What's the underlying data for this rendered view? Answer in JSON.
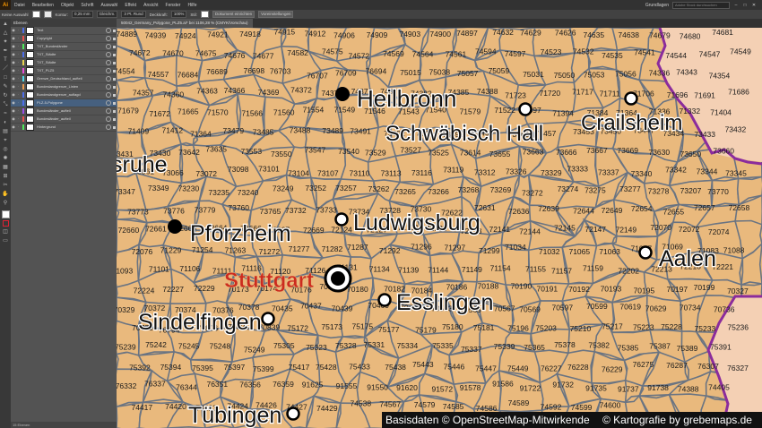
{
  "app": {
    "logo": "Ai",
    "menu": [
      "Datei",
      "Bearbeiten",
      "Objekt",
      "Schrift",
      "Auswahl",
      "Effekt",
      "Ansicht",
      "Fenster",
      "Hilfe"
    ],
    "workspace": "Grundlagen",
    "search_placeholder": "Adobe Stock durchsuchen",
    "window_buttons": [
      "–",
      "□",
      "✕"
    ]
  },
  "controlbar": {
    "selection_label": "Keine Auswahl",
    "stroke_label": "Kontur:",
    "stroke_value": "0,25 mm",
    "style_value": "Gleichm.",
    "brush_value": "3 Pt. Rund",
    "opacity_label": "Deckkraft:",
    "opacity_value": "100%",
    "style_label": "Stil:",
    "doc_setup_button": "Dokument einrichten",
    "prefs_button": "Voreinstellungen"
  },
  "document": {
    "tab_title": "50042_Germany_Polygone_PLZ5.ai* bei 1106,28 % (CMYK/Vorschau)"
  },
  "layers_panel": {
    "title": "Ebenen",
    "footer": "15 Ebenen",
    "layers": [
      {
        "name": "Text",
        "color": "#4f6ee8",
        "selected": false
      },
      {
        "name": "Copyright",
        "color": "#e84f4f",
        "selected": false
      },
      {
        "name": "TXT_Bundesländer",
        "color": "#4fe85a",
        "selected": false
      },
      {
        "name": "TXT_Städte",
        "color": "#4f6ee8",
        "selected": false
      },
      {
        "name": "TXT_Städte",
        "color": "#e8d24f",
        "selected": false
      },
      {
        "name": "TXT_PLZ5",
        "color": "#e84fd8",
        "selected": false
      },
      {
        "name": "Grenze_Deutschland_aufteil",
        "color": "#4fd8e8",
        "selected": false
      },
      {
        "name": "Bundeslandgrenze_Linien",
        "color": "#e89a4f",
        "selected": false
      },
      {
        "name": "Bundeslandgrenze_auflagd",
        "color": "#4f6ee8",
        "selected": false
      },
      {
        "name": "PLZ-5-Polygone",
        "color": "#4f6ee8",
        "selected": true
      },
      {
        "name": "Bundesländer_aufteil",
        "color": "#9a4fe8",
        "selected": false
      },
      {
        "name": "Bundesländer_aufteil",
        "color": "#e84f4f",
        "selected": false
      },
      {
        "name": "Hintergrund",
        "color": "#4fe85a",
        "selected": false
      }
    ]
  },
  "map": {
    "colors": {
      "land": "#e9b97d",
      "borders": "#6a7482",
      "neighbor": "#f4d0b4",
      "state_border": "#8b2c9c",
      "city_label": "#111111",
      "capital_label": "#cc2b1f"
    },
    "cities": [
      {
        "name": "Heilbronn",
        "marker": "filled"
      },
      {
        "name": "Schwäbisch Hall",
        "marker": "hollow"
      },
      {
        "name": "Crailsheim",
        "marker": "hollow"
      },
      {
        "name": "Ludwigsburg",
        "marker": "hollow"
      },
      {
        "name": "Pforzheim",
        "marker": "filled"
      },
      {
        "name": "Aalen",
        "marker": "hollow"
      },
      {
        "name": "Stuttgart",
        "marker": "capital"
      },
      {
        "name": "Esslingen",
        "marker": "hollow"
      },
      {
        "name": "Sindelfingen",
        "marker": "hollow"
      },
      {
        "name": "Tübingen",
        "marker": "hollow"
      },
      {
        "name": "sruhe",
        "marker": "none"
      }
    ],
    "postcodes": [
      {
        "code": "74889"
      },
      {
        "code": "74939"
      },
      {
        "code": "74924"
      },
      {
        "code": "74921"
      },
      {
        "code": "74918"
      },
      {
        "code": "74915"
      },
      {
        "code": "74912"
      },
      {
        "code": "74906"
      },
      {
        "code": "74909"
      },
      {
        "code": "74903"
      },
      {
        "code": "74900"
      },
      {
        "code": "74897"
      },
      {
        "code": "74632"
      },
      {
        "code": "74629"
      },
      {
        "code": "74626"
      },
      {
        "code": "74635"
      },
      {
        "code": "74638"
      },
      {
        "code": "74679"
      },
      {
        "code": "74680"
      },
      {
        "code": "74681"
      },
      {
        "code": "74672"
      },
      {
        "code": "74670"
      },
      {
        "code": "74675"
      },
      {
        "code": "74676"
      },
      {
        "code": "74677"
      },
      {
        "code": "74582"
      },
      {
        "code": "74575"
      },
      {
        "code": "74572"
      },
      {
        "code": "74569"
      },
      {
        "code": "74564"
      },
      {
        "code": "74561"
      },
      {
        "code": "74594"
      },
      {
        "code": "74597"
      },
      {
        "code": "74523"
      },
      {
        "code": "74532"
      },
      {
        "code": "74535"
      },
      {
        "code": "74541"
      },
      {
        "code": "74544"
      },
      {
        "code": "74547"
      },
      {
        "code": "74549"
      },
      {
        "code": "74554"
      },
      {
        "code": "74557"
      },
      {
        "code": "76684"
      },
      {
        "code": "76689"
      },
      {
        "code": "76698"
      },
      {
        "code": "76703"
      },
      {
        "code": "76707"
      },
      {
        "code": "76709"
      },
      {
        "code": "76694"
      },
      {
        "code": "75015"
      },
      {
        "code": "75038"
      },
      {
        "code": "75057"
      },
      {
        "code": "75059"
      },
      {
        "code": "75031"
      },
      {
        "code": "75050"
      },
      {
        "code": "75053"
      },
      {
        "code": "75056"
      },
      {
        "code": "74336"
      },
      {
        "code": "74343"
      },
      {
        "code": "74354"
      },
      {
        "code": "74357"
      },
      {
        "code": "74360"
      },
      {
        "code": "74363"
      },
      {
        "code": "74366"
      },
      {
        "code": "74369"
      },
      {
        "code": "74372"
      },
      {
        "code": "74374"
      },
      {
        "code": "74376"
      },
      {
        "code": "74379"
      },
      {
        "code": "74382"
      },
      {
        "code": "74385"
      },
      {
        "code": "74388"
      },
      {
        "code": "71723"
      },
      {
        "code": "71720"
      },
      {
        "code": "71717"
      },
      {
        "code": "71711"
      },
      {
        "code": "71706"
      },
      {
        "code": "71696"
      },
      {
        "code": "71691"
      },
      {
        "code": "71686"
      },
      {
        "code": "71679"
      },
      {
        "code": "71672"
      },
      {
        "code": "71665"
      },
      {
        "code": "71570"
      },
      {
        "code": "71566"
      },
      {
        "code": "71560"
      },
      {
        "code": "71554"
      },
      {
        "code": "71549"
      },
      {
        "code": "71546"
      },
      {
        "code": "71543"
      },
      {
        "code": "71540"
      },
      {
        "code": "71579"
      },
      {
        "code": "71522"
      },
      {
        "code": "71397"
      },
      {
        "code": "71394"
      },
      {
        "code": "71384"
      },
      {
        "code": "71364"
      },
      {
        "code": "71336"
      },
      {
        "code": "71332"
      },
      {
        "code": "71404"
      },
      {
        "code": "71409"
      },
      {
        "code": "71412"
      },
      {
        "code": "71364"
      },
      {
        "code": "73479"
      },
      {
        "code": "73485"
      },
      {
        "code": "73488"
      },
      {
        "code": "73489"
      },
      {
        "code": "73491"
      },
      {
        "code": "73492"
      },
      {
        "code": "73494"
      },
      {
        "code": "73495"
      },
      {
        "code": "73466"
      },
      {
        "code": "73460"
      },
      {
        "code": "73457"
      },
      {
        "code": "73453"
      },
      {
        "code": "73450"
      },
      {
        "code": "73447"
      },
      {
        "code": "73434"
      },
      {
        "code": "73433"
      },
      {
        "code": "73432"
      },
      {
        "code": "73431"
      },
      {
        "code": "73430"
      },
      {
        "code": "73642"
      },
      {
        "code": "73635"
      },
      {
        "code": "73553"
      },
      {
        "code": "73550"
      },
      {
        "code": "73547"
      },
      {
        "code": "73540"
      },
      {
        "code": "73529"
      },
      {
        "code": "73527"
      },
      {
        "code": "73525"
      },
      {
        "code": "73614"
      },
      {
        "code": "73655"
      },
      {
        "code": "73663"
      },
      {
        "code": "73666"
      },
      {
        "code": "73667"
      },
      {
        "code": "73669"
      },
      {
        "code": "73630"
      },
      {
        "code": "73650"
      },
      {
        "code": "73660"
      },
      {
        "code": "73061"
      },
      {
        "code": "73066"
      },
      {
        "code": "73072"
      },
      {
        "code": "73098"
      },
      {
        "code": "73101"
      },
      {
        "code": "73104"
      },
      {
        "code": "73107"
      },
      {
        "code": "73110"
      },
      {
        "code": "73113"
      },
      {
        "code": "73116"
      },
      {
        "code": "73119"
      },
      {
        "code": "73312"
      },
      {
        "code": "73326"
      },
      {
        "code": "73329"
      },
      {
        "code": "73333"
      },
      {
        "code": "73337"
      },
      {
        "code": "73340"
      },
      {
        "code": "73342"
      },
      {
        "code": "73344"
      },
      {
        "code": "73345"
      },
      {
        "code": "73347"
      },
      {
        "code": "73349"
      },
      {
        "code": "73230"
      },
      {
        "code": "73235"
      },
      {
        "code": "73240"
      },
      {
        "code": "73249"
      },
      {
        "code": "73252"
      },
      {
        "code": "73257"
      },
      {
        "code": "73262"
      },
      {
        "code": "73265"
      },
      {
        "code": "73266"
      },
      {
        "code": "73268"
      },
      {
        "code": "73269"
      },
      {
        "code": "73272"
      },
      {
        "code": "73274"
      },
      {
        "code": "73275"
      },
      {
        "code": "73277"
      },
      {
        "code": "73278"
      },
      {
        "code": "73207"
      },
      {
        "code": "73770"
      },
      {
        "code": "73773"
      },
      {
        "code": "73776"
      },
      {
        "code": "73779"
      },
      {
        "code": "73760"
      },
      {
        "code": "73765"
      },
      {
        "code": "73732"
      },
      {
        "code": "73733"
      },
      {
        "code": "73734"
      },
      {
        "code": "73728"
      },
      {
        "code": "73730"
      },
      {
        "code": "72622"
      },
      {
        "code": "72631"
      },
      {
        "code": "72636"
      },
      {
        "code": "72639"
      },
      {
        "code": "72644"
      },
      {
        "code": "72649"
      },
      {
        "code": "72654"
      },
      {
        "code": "72655"
      },
      {
        "code": "72657"
      },
      {
        "code": "72658"
      },
      {
        "code": "72660"
      },
      {
        "code": "72661"
      },
      {
        "code": "72663"
      },
      {
        "code": "72664"
      },
      {
        "code": "72666"
      },
      {
        "code": "72667"
      },
      {
        "code": "72669"
      },
      {
        "code": "72124"
      },
      {
        "code": "72127"
      },
      {
        "code": "72131"
      },
      {
        "code": "72135"
      },
      {
        "code": "72138"
      },
      {
        "code": "72141"
      },
      {
        "code": "72144"
      },
      {
        "code": "72145"
      },
      {
        "code": "72147"
      },
      {
        "code": "72149"
      },
      {
        "code": "72070"
      },
      {
        "code": "72072"
      },
      {
        "code": "72074"
      },
      {
        "code": "72076"
      },
      {
        "code": "71229"
      },
      {
        "code": "71254"
      },
      {
        "code": "71263"
      },
      {
        "code": "71272"
      },
      {
        "code": "71277"
      },
      {
        "code": "71282"
      },
      {
        "code": "71287"
      },
      {
        "code": "71292"
      },
      {
        "code": "71296"
      },
      {
        "code": "71297"
      },
      {
        "code": "71299"
      },
      {
        "code": "71034"
      },
      {
        "code": "71032"
      },
      {
        "code": "71065"
      },
      {
        "code": "71063"
      },
      {
        "code": "71067"
      },
      {
        "code": "71069"
      },
      {
        "code": "71083"
      },
      {
        "code": "71088"
      },
      {
        "code": "71093"
      },
      {
        "code": "71101"
      },
      {
        "code": "71106"
      },
      {
        "code": "71111"
      },
      {
        "code": "71116"
      },
      {
        "code": "71120"
      },
      {
        "code": "71126"
      },
      {
        "code": "71131"
      },
      {
        "code": "71134"
      },
      {
        "code": "71139"
      },
      {
        "code": "71144"
      },
      {
        "code": "71149"
      },
      {
        "code": "71154"
      },
      {
        "code": "71155"
      },
      {
        "code": "71157"
      },
      {
        "code": "71159"
      },
      {
        "code": "72202"
      },
      {
        "code": "72213"
      },
      {
        "code": "72218"
      },
      {
        "code": "72221"
      },
      {
        "code": "72224"
      },
      {
        "code": "72227"
      },
      {
        "code": "72229"
      },
      {
        "code": "70173"
      },
      {
        "code": "70174"
      },
      {
        "code": "70176"
      },
      {
        "code": "70178"
      },
      {
        "code": "70180"
      },
      {
        "code": "70182"
      },
      {
        "code": "70184"
      },
      {
        "code": "70186"
      },
      {
        "code": "70188"
      },
      {
        "code": "70190"
      },
      {
        "code": "70191"
      },
      {
        "code": "70192"
      },
      {
        "code": "70193"
      },
      {
        "code": "70195"
      },
      {
        "code": "70197"
      },
      {
        "code": "70199"
      },
      {
        "code": "70327"
      },
      {
        "code": "70329"
      },
      {
        "code": "70372"
      },
      {
        "code": "70374"
      },
      {
        "code": "70376"
      },
      {
        "code": "70378"
      },
      {
        "code": "70435"
      },
      {
        "code": "70437"
      },
      {
        "code": "70439"
      },
      {
        "code": "70469"
      },
      {
        "code": "70499"
      },
      {
        "code": "70563"
      },
      {
        "code": "70565"
      },
      {
        "code": "70567"
      },
      {
        "code": "70569"
      },
      {
        "code": "70597"
      },
      {
        "code": "70599"
      },
      {
        "code": "70619"
      },
      {
        "code": "70629"
      },
      {
        "code": "70734"
      },
      {
        "code": "70736"
      },
      {
        "code": "70771"
      },
      {
        "code": "70794"
      },
      {
        "code": "70806"
      },
      {
        "code": "70825"
      },
      {
        "code": "70839"
      },
      {
        "code": "75172"
      },
      {
        "code": "75173"
      },
      {
        "code": "75175"
      },
      {
        "code": "75177"
      },
      {
        "code": "75179"
      },
      {
        "code": "75180"
      },
      {
        "code": "75181"
      },
      {
        "code": "75196"
      },
      {
        "code": "75203"
      },
      {
        "code": "75210"
      },
      {
        "code": "75217"
      },
      {
        "code": "75223"
      },
      {
        "code": "75228"
      },
      {
        "code": "75233"
      },
      {
        "code": "75236"
      },
      {
        "code": "75239"
      },
      {
        "code": "75242"
      },
      {
        "code": "75245"
      },
      {
        "code": "75248"
      },
      {
        "code": "75249"
      },
      {
        "code": "75305"
      },
      {
        "code": "75323"
      },
      {
        "code": "75328"
      },
      {
        "code": "75331"
      },
      {
        "code": "75334"
      },
      {
        "code": "75335"
      },
      {
        "code": "75337"
      },
      {
        "code": "75339"
      },
      {
        "code": "75365"
      },
      {
        "code": "75378"
      },
      {
        "code": "75382"
      },
      {
        "code": "75385"
      },
      {
        "code": "75387"
      },
      {
        "code": "75389"
      },
      {
        "code": "75391"
      },
      {
        "code": "75392"
      },
      {
        "code": "75394"
      },
      {
        "code": "75395"
      },
      {
        "code": "75397"
      },
      {
        "code": "75399"
      },
      {
        "code": "75417"
      },
      {
        "code": "75428"
      },
      {
        "code": "75433"
      },
      {
        "code": "75438"
      },
      {
        "code": "75443"
      },
      {
        "code": "75446"
      },
      {
        "code": "75447"
      },
      {
        "code": "75449"
      },
      {
        "code": "76227"
      },
      {
        "code": "76228"
      },
      {
        "code": "76229"
      },
      {
        "code": "76275"
      },
      {
        "code": "76287"
      },
      {
        "code": "76307"
      },
      {
        "code": "76327"
      },
      {
        "code": "76332"
      },
      {
        "code": "76337"
      },
      {
        "code": "76344"
      },
      {
        "code": "76351"
      },
      {
        "code": "76356"
      },
      {
        "code": "76359"
      },
      {
        "code": "91625"
      },
      {
        "code": "91555"
      },
      {
        "code": "91550"
      },
      {
        "code": "91620"
      },
      {
        "code": "91572"
      },
      {
        "code": "91578"
      },
      {
        "code": "91586"
      },
      {
        "code": "91722"
      },
      {
        "code": "91732"
      },
      {
        "code": "91735"
      },
      {
        "code": "91737"
      },
      {
        "code": "91738"
      },
      {
        "code": "74388"
      },
      {
        "code": "74405"
      },
      {
        "code": "74417"
      },
      {
        "code": "74420"
      },
      {
        "code": "74423"
      },
      {
        "code": "74424"
      },
      {
        "code": "74426"
      },
      {
        "code": "74427"
      },
      {
        "code": "74429"
      },
      {
        "code": "74538"
      },
      {
        "code": "74567"
      },
      {
        "code": "74579"
      },
      {
        "code": "74585"
      },
      {
        "code": "74586"
      },
      {
        "code": "74589"
      },
      {
        "code": "74592"
      },
      {
        "code": "74599"
      },
      {
        "code": "74600"
      }
    ]
  },
  "credits": {
    "left": "Basisdaten © OpenStreetMap-Mitwirkende",
    "right": "© Kartografie by grebemaps.de"
  }
}
